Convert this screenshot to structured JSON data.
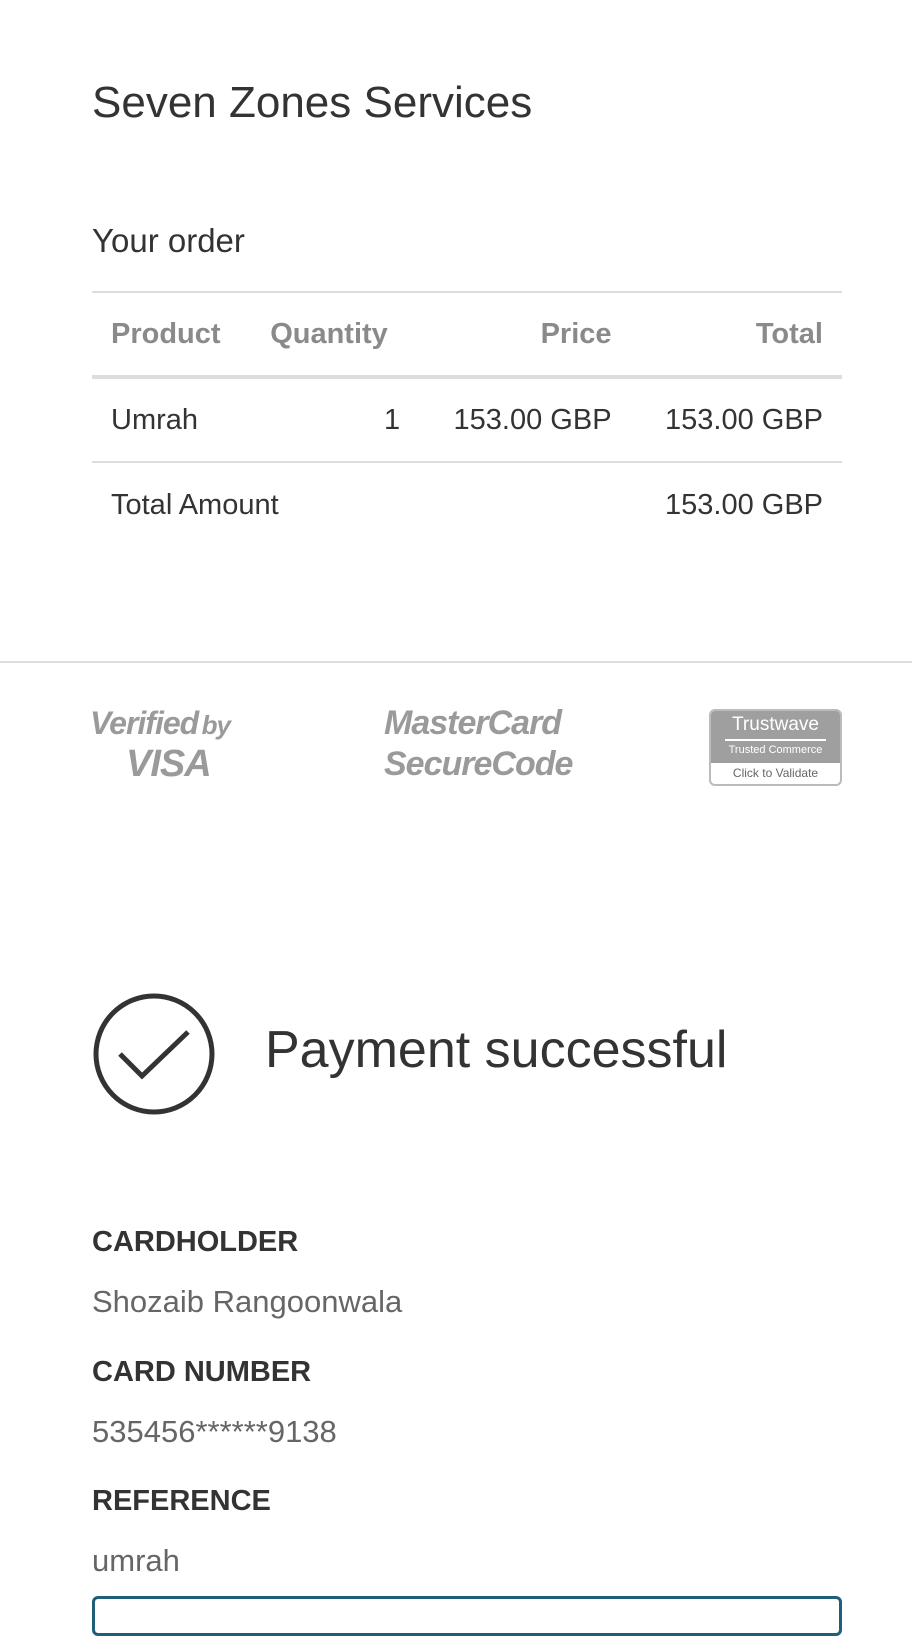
{
  "merchant": "Seven Zones Services",
  "order": {
    "heading": "Your order",
    "columns": [
      "Product",
      "Quantity",
      "Price",
      "Total"
    ],
    "rows": [
      {
        "product": "Umrah",
        "quantity": "1",
        "price": "153.00 GBP",
        "total": "153.00 GBP"
      }
    ],
    "total_label": "Total Amount",
    "total_value": "153.00 GBP"
  },
  "badges": {
    "visa": [
      "Verified",
      "by",
      "VISA"
    ],
    "mastercard": [
      "MasterCard",
      "SecureCode"
    ],
    "trustwave": [
      "Trustwave",
      "Trusted Commerce",
      "Click to Validate"
    ]
  },
  "status": {
    "icon": "check-circle-icon",
    "text": "Payment successful"
  },
  "details": [
    {
      "label": "CARDHOLDER",
      "value": "Shozaib Rangoonwala"
    },
    {
      "label": "CARD NUMBER",
      "value": "535456******9138"
    },
    {
      "label": "REFERENCE",
      "value": "umrah"
    }
  ],
  "colors": {
    "button_border": "#1f5f7a"
  }
}
